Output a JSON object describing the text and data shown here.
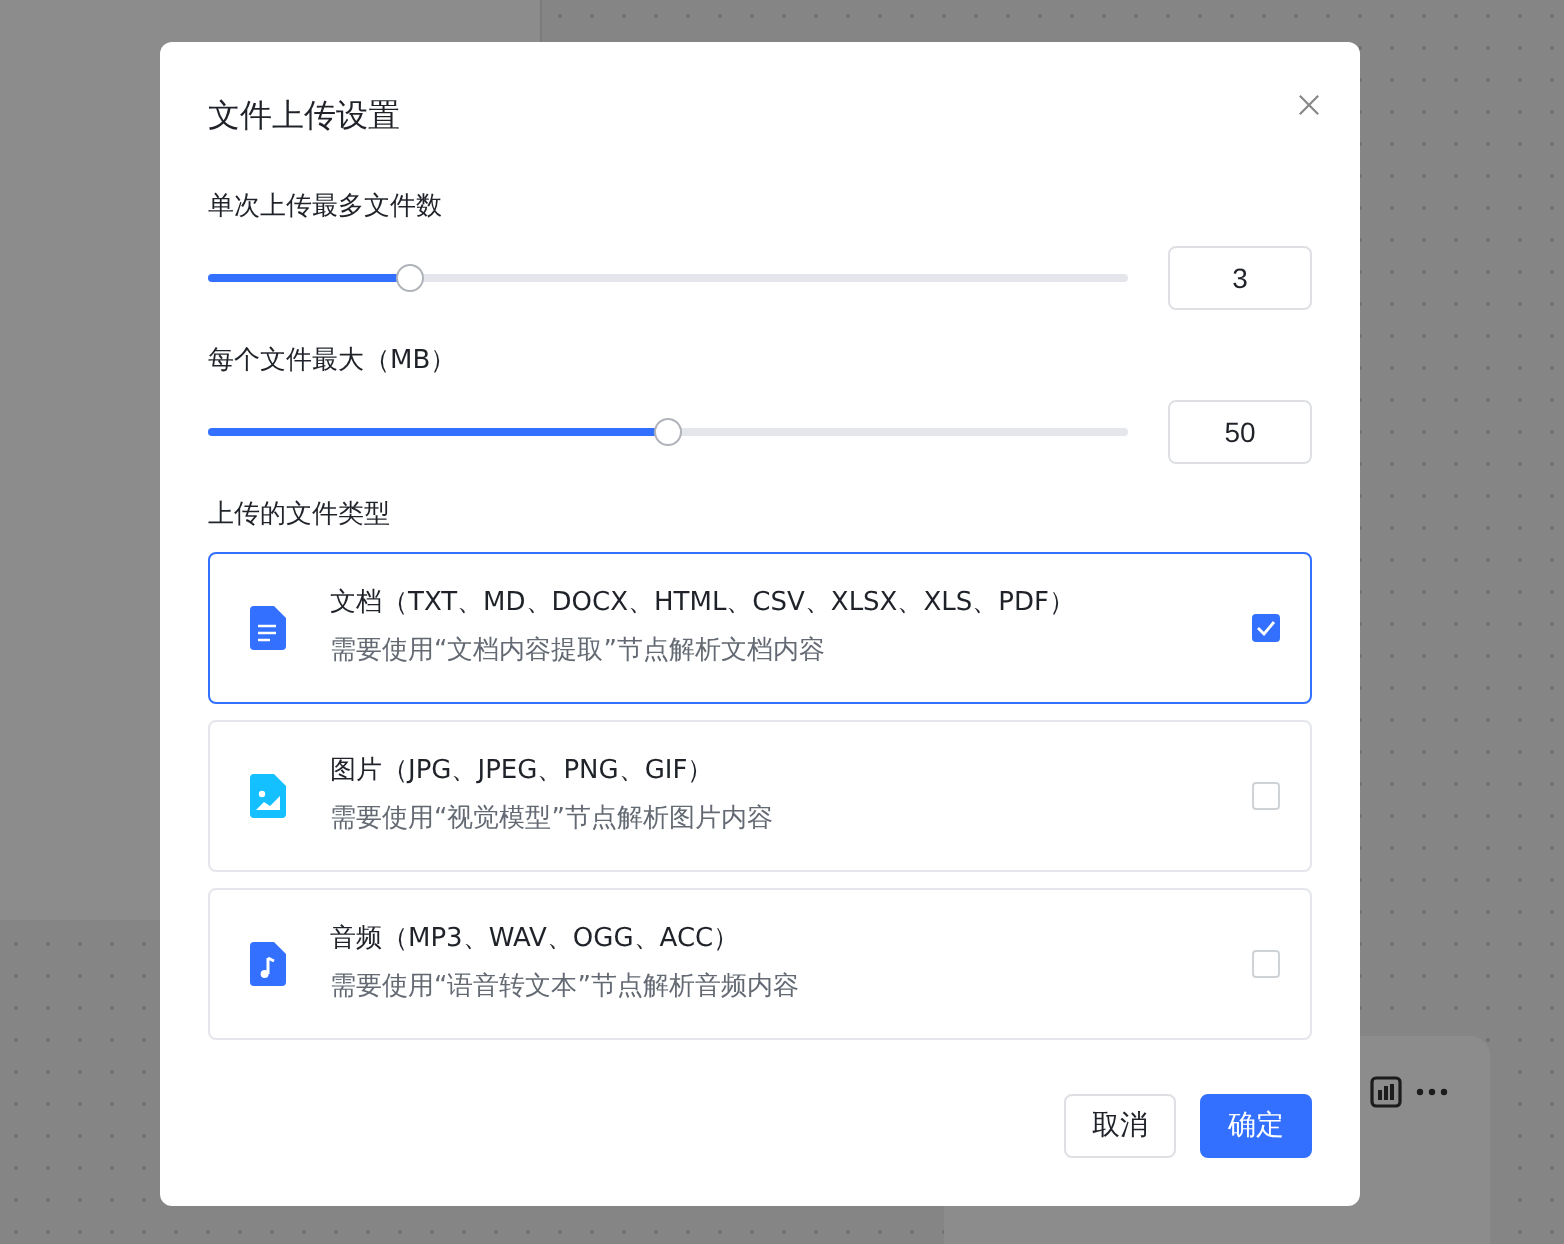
{
  "dialog": {
    "title": "文件上传设置",
    "sliders": [
      {
        "label": "单次上传最多文件数",
        "level": 0.22,
        "value": "3"
      },
      {
        "label": "每个文件最大（MB）",
        "level": 0.5,
        "value": "50"
      }
    ],
    "types_label": "上传的文件类型",
    "file_types": [
      {
        "kind": "document",
        "title": "文档（TXT、MD、DOCX、HTML、CSV、XLSX、XLS、PDF）",
        "hint": "需要使用“文档内容提取”节点解析文档内容",
        "checked": true,
        "selected": true
      },
      {
        "kind": "image",
        "title": "图片（JPG、JPEG、PNG、GIF）",
        "hint": "需要使用“视觉模型”节点解析图片内容",
        "checked": false,
        "selected": false
      },
      {
        "kind": "audio",
        "title": "音频（MP3、WAV、OGG、ACC）",
        "hint": "需要使用“语音转文本”节点解析音频内容",
        "checked": false,
        "selected": false
      }
    ],
    "buttons": [
      {
        "kind": "secondary",
        "label": "取消"
      },
      {
        "kind": "primary",
        "label": "确定"
      }
    ]
  }
}
